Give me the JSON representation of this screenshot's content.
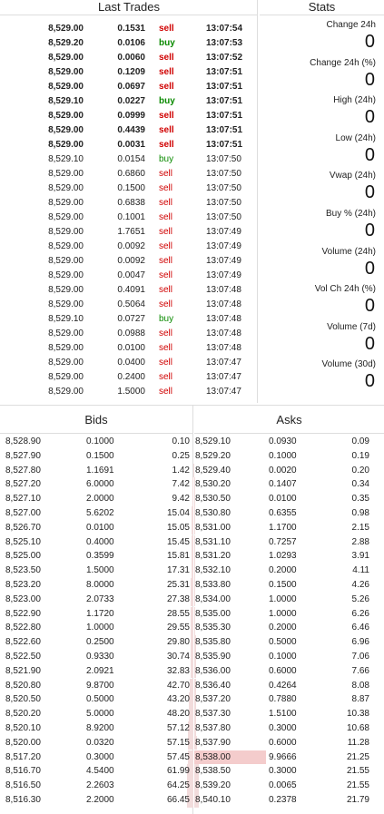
{
  "trades": {
    "title": "Last Trades",
    "rows": [
      {
        "price": "8,529.00",
        "amount": "0.1531",
        "side": "sell",
        "time": "13:07:54",
        "bold": true
      },
      {
        "price": "8,529.20",
        "amount": "0.0106",
        "side": "buy",
        "time": "13:07:53",
        "bold": true
      },
      {
        "price": "8,529.00",
        "amount": "0.0060",
        "side": "sell",
        "time": "13:07:52",
        "bold": true
      },
      {
        "price": "8,529.00",
        "amount": "0.1209",
        "side": "sell",
        "time": "13:07:51",
        "bold": true
      },
      {
        "price": "8,529.00",
        "amount": "0.0697",
        "side": "sell",
        "time": "13:07:51",
        "bold": true
      },
      {
        "price": "8,529.10",
        "amount": "0.0227",
        "side": "buy",
        "time": "13:07:51",
        "bold": true
      },
      {
        "price": "8,529.00",
        "amount": "0.0999",
        "side": "sell",
        "time": "13:07:51",
        "bold": true
      },
      {
        "price": "8,529.00",
        "amount": "0.4439",
        "side": "sell",
        "time": "13:07:51",
        "bold": true
      },
      {
        "price": "8,529.00",
        "amount": "0.0031",
        "side": "sell",
        "time": "13:07:51",
        "bold": true
      },
      {
        "price": "8,529.10",
        "amount": "0.0154",
        "side": "buy",
        "time": "13:07:50",
        "bold": false
      },
      {
        "price": "8,529.00",
        "amount": "0.6860",
        "side": "sell",
        "time": "13:07:50",
        "bold": false
      },
      {
        "price": "8,529.00",
        "amount": "0.1500",
        "side": "sell",
        "time": "13:07:50",
        "bold": false
      },
      {
        "price": "8,529.00",
        "amount": "0.6838",
        "side": "sell",
        "time": "13:07:50",
        "bold": false
      },
      {
        "price": "8,529.00",
        "amount": "0.1001",
        "side": "sell",
        "time": "13:07:50",
        "bold": false
      },
      {
        "price": "8,529.00",
        "amount": "1.7651",
        "side": "sell",
        "time": "13:07:49",
        "bold": false
      },
      {
        "price": "8,529.00",
        "amount": "0.0092",
        "side": "sell",
        "time": "13:07:49",
        "bold": false
      },
      {
        "price": "8,529.00",
        "amount": "0.0092",
        "side": "sell",
        "time": "13:07:49",
        "bold": false
      },
      {
        "price": "8,529.00",
        "amount": "0.0047",
        "side": "sell",
        "time": "13:07:49",
        "bold": false
      },
      {
        "price": "8,529.00",
        "amount": "0.4091",
        "side": "sell",
        "time": "13:07:48",
        "bold": false
      },
      {
        "price": "8,529.00",
        "amount": "0.5064",
        "side": "sell",
        "time": "13:07:48",
        "bold": false
      },
      {
        "price": "8,529.10",
        "amount": "0.0727",
        "side": "buy",
        "time": "13:07:48",
        "bold": false
      },
      {
        "price": "8,529.00",
        "amount": "0.0988",
        "side": "sell",
        "time": "13:07:48",
        "bold": false
      },
      {
        "price": "8,529.00",
        "amount": "0.0100",
        "side": "sell",
        "time": "13:07:48",
        "bold": false
      },
      {
        "price": "8,529.00",
        "amount": "0.0400",
        "side": "sell",
        "time": "13:07:47",
        "bold": false
      },
      {
        "price": "8,529.00",
        "amount": "0.2400",
        "side": "sell",
        "time": "13:07:47",
        "bold": false
      },
      {
        "price": "8,529.00",
        "amount": "1.5000",
        "side": "sell",
        "time": "13:07:47",
        "bold": false
      }
    ]
  },
  "stats": {
    "title": "Stats",
    "items": [
      {
        "label": "Change 24h",
        "value": "0"
      },
      {
        "label": "Change 24h (%)",
        "value": "0"
      },
      {
        "label": "High (24h)",
        "value": "0"
      },
      {
        "label": "Low (24h)",
        "value": "0"
      },
      {
        "label": "Vwap (24h)",
        "value": "0"
      },
      {
        "label": "Buy % (24h)",
        "value": "0"
      },
      {
        "label": "Volume (24h)",
        "value": "0"
      },
      {
        "label": "Vol Ch 24h (%)",
        "value": "0"
      },
      {
        "label": "Volume (7d)",
        "value": "0"
      },
      {
        "label": "Volume (30d)",
        "value": "0"
      }
    ]
  },
  "bids": {
    "title": "Bids",
    "rows": [
      {
        "price": "8,528.90",
        "amount": "0.1000",
        "total": "0.10",
        "depth": 0.002
      },
      {
        "price": "8,527.90",
        "amount": "0.1500",
        "total": "0.25",
        "depth": 0.004
      },
      {
        "price": "8,527.80",
        "amount": "1.1691",
        "total": "1.42",
        "depth": 0.021
      },
      {
        "price": "8,527.20",
        "amount": "6.0000",
        "total": "7.42",
        "depth": 0.112
      },
      {
        "price": "8,527.10",
        "amount": "2.0000",
        "total": "9.42",
        "depth": 0.142
      },
      {
        "price": "8,527.00",
        "amount": "5.6202",
        "total": "15.04",
        "depth": 0.226
      },
      {
        "price": "8,526.70",
        "amount": "0.0100",
        "total": "15.05",
        "depth": 0.226
      },
      {
        "price": "8,525.10",
        "amount": "0.4000",
        "total": "15.45",
        "depth": 0.232
      },
      {
        "price": "8,525.00",
        "amount": "0.3599",
        "total": "15.81",
        "depth": 0.238
      },
      {
        "price": "8,523.50",
        "amount": "1.5000",
        "total": "17.31",
        "depth": 0.26
      },
      {
        "price": "8,523.20",
        "amount": "8.0000",
        "total": "25.31",
        "depth": 0.381
      },
      {
        "price": "8,523.00",
        "amount": "2.0733",
        "total": "27.38",
        "depth": 0.412
      },
      {
        "price": "8,522.90",
        "amount": "1.1720",
        "total": "28.55",
        "depth": 0.429
      },
      {
        "price": "8,522.80",
        "amount": "1.0000",
        "total": "29.55",
        "depth": 0.444
      },
      {
        "price": "8,522.60",
        "amount": "0.2500",
        "total": "29.80",
        "depth": 0.448
      },
      {
        "price": "8,522.50",
        "amount": "0.9330",
        "total": "30.74",
        "depth": 0.462
      },
      {
        "price": "8,521.90",
        "amount": "2.0921",
        "total": "32.83",
        "depth": 0.494
      },
      {
        "price": "8,520.80",
        "amount": "9.8700",
        "total": "42.70",
        "depth": 0.642
      },
      {
        "price": "8,520.50",
        "amount": "0.5000",
        "total": "43.20",
        "depth": 0.65
      },
      {
        "price": "8,520.20",
        "amount": "5.0000",
        "total": "48.20",
        "depth": 0.725
      },
      {
        "price": "8,520.10",
        "amount": "8.9200",
        "total": "57.12",
        "depth": 0.859
      },
      {
        "price": "8,520.00",
        "amount": "0.0320",
        "total": "57.15",
        "depth": 0.859
      },
      {
        "price": "8,517.20",
        "amount": "0.3000",
        "total": "57.45",
        "depth": 0.864
      },
      {
        "price": "8,516.70",
        "amount": "4.5400",
        "total": "61.99",
        "depth": 0.932
      },
      {
        "price": "8,516.50",
        "amount": "2.2603",
        "total": "64.25",
        "depth": 0.966
      },
      {
        "price": "8,516.30",
        "amount": "2.2000",
        "total": "66.45",
        "depth": 1.0
      }
    ]
  },
  "asks": {
    "title": "Asks",
    "rows": [
      {
        "price": "8,529.10",
        "amount": "0.0930",
        "total": "0.09",
        "depth": 0.004
      },
      {
        "price": "8,529.20",
        "amount": "0.1000",
        "total": "0.19",
        "depth": 0.009
      },
      {
        "price": "8,529.40",
        "amount": "0.0020",
        "total": "0.20",
        "depth": 0.009
      },
      {
        "price": "8,530.20",
        "amount": "0.1407",
        "total": "0.34",
        "depth": 0.016
      },
      {
        "price": "8,530.50",
        "amount": "0.0100",
        "total": "0.35",
        "depth": 0.016
      },
      {
        "price": "8,530.80",
        "amount": "0.6355",
        "total": "0.98",
        "depth": 0.045
      },
      {
        "price": "8,531.00",
        "amount": "1.1700",
        "total": "2.15",
        "depth": 0.099
      },
      {
        "price": "8,531.10",
        "amount": "0.7257",
        "total": "2.88",
        "depth": 0.132
      },
      {
        "price": "8,531.20",
        "amount": "1.0293",
        "total": "3.91",
        "depth": 0.18
      },
      {
        "price": "8,532.10",
        "amount": "0.2000",
        "total": "4.11",
        "depth": 0.189
      },
      {
        "price": "8,533.80",
        "amount": "0.1500",
        "total": "4.26",
        "depth": 0.196
      },
      {
        "price": "8,534.00",
        "amount": "1.0000",
        "total": "5.26",
        "depth": 0.242
      },
      {
        "price": "8,535.00",
        "amount": "1.0000",
        "total": "6.26",
        "depth": 0.287
      },
      {
        "price": "8,535.30",
        "amount": "0.2000",
        "total": "6.46",
        "depth": 0.296
      },
      {
        "price": "8,535.80",
        "amount": "0.5000",
        "total": "6.96",
        "depth": 0.319
      },
      {
        "price": "8,535.90",
        "amount": "0.1000",
        "total": "7.06",
        "depth": 0.324
      },
      {
        "price": "8,536.00",
        "amount": "0.6000",
        "total": "7.66",
        "depth": 0.352
      },
      {
        "price": "8,536.40",
        "amount": "0.4264",
        "total": "8.08",
        "depth": 0.371
      },
      {
        "price": "8,537.20",
        "amount": "0.7880",
        "total": "8.87",
        "depth": 0.407
      },
      {
        "price": "8,537.30",
        "amount": "1.5100",
        "total": "10.38",
        "depth": 0.476
      },
      {
        "price": "8,537.80",
        "amount": "0.3000",
        "total": "10.68",
        "depth": 0.49
      },
      {
        "price": "8,537.90",
        "amount": "0.6000",
        "total": "11.28",
        "depth": 0.517
      },
      {
        "price": "8,538.00",
        "amount": "9.9666",
        "total": "21.25",
        "depth": 0.975,
        "highlight": true
      },
      {
        "price": "8,538.50",
        "amount": "0.3000",
        "total": "21.55",
        "depth": 0.989
      },
      {
        "price": "8,539.20",
        "amount": "0.0065",
        "total": "21.55",
        "depth": 0.989
      },
      {
        "price": "8,540.10",
        "amount": "0.2378",
        "total": "21.79",
        "depth": 1.0
      }
    ]
  }
}
